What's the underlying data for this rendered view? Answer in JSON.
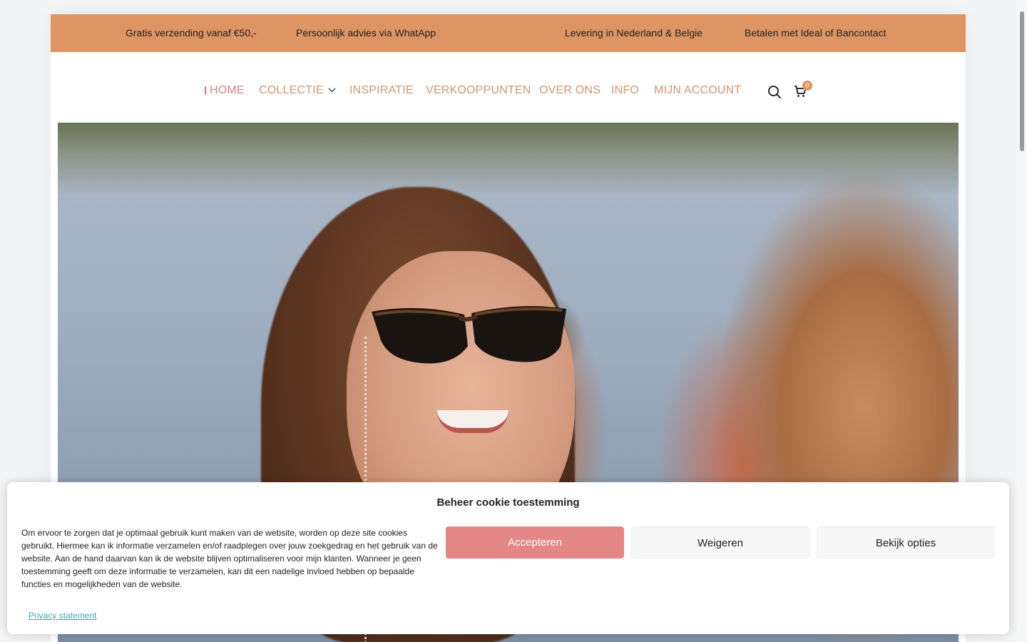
{
  "topbar": {
    "items": [
      "Gratis verzending vanaf €50,-",
      "Persoonlijk advies via WhatApp",
      "Levering in Nederland & Belgie",
      "Betalen met Ideal of Bancontact"
    ]
  },
  "nav": {
    "items": [
      {
        "label": "HOME",
        "active": true
      },
      {
        "label": "COLLECTIE",
        "has_dropdown": true
      },
      {
        "label": "INSPIRATIE"
      },
      {
        "label": "VERKOOPPUNTEN"
      },
      {
        "label": "OVER ONS"
      },
      {
        "label": "INFO"
      },
      {
        "label": "MIJN ACCOUNT"
      }
    ],
    "search_icon": "search-icon",
    "cart_icon": "cart-icon",
    "cart_count": "0"
  },
  "cookie": {
    "title": "Beheer cookie toestemming",
    "text": "Om ervoor te zorgen dat je optimaal gebruik kunt maken van de website, worden op deze site cookies gebruikt. Hiermee kan ik informatie verzamelen en/of raadplegen over jouw zoekgedrag en het gebruik van de website. Aan de hand daarvan kan ik de website blijven optimaliseren voor mijn klanten. Wanneer je geen toestemming geeft om deze informatie te verzamelen, kan dit een nadelige invloed hebben op bepaalde functies en mogelijkheden van de website.",
    "accept_label": "Accepteren",
    "deny_label": "Weigeren",
    "options_label": "Bekijk opties",
    "privacy_label": "Privacy statement"
  },
  "colors": {
    "accent": "#df9463",
    "nav_text": "#d8936a",
    "accept_button": "#e58686",
    "privacy_link": "#3aa8a8"
  }
}
